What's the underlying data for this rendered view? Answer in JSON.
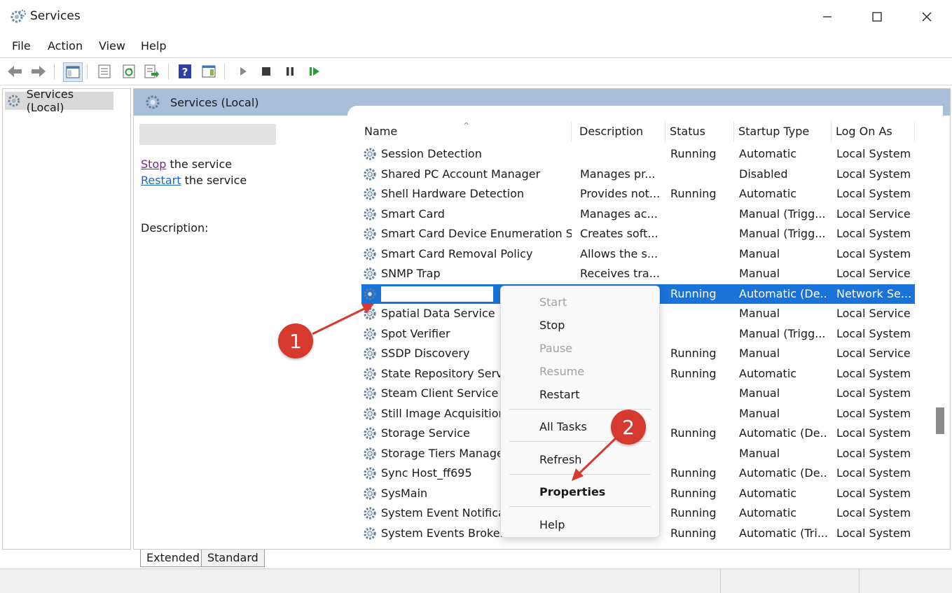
{
  "window": {
    "title": "Services"
  },
  "menu": [
    "File",
    "Action",
    "View",
    "Help"
  ],
  "tree": {
    "root": "Services (Local)"
  },
  "pane": {
    "header": "Services (Local)",
    "actions": [
      {
        "link": "Stop",
        "rest": " the service"
      },
      {
        "link": "Restart",
        "rest": " the service"
      }
    ],
    "description_label": "Description:"
  },
  "columns": [
    "Name",
    "Description",
    "Status",
    "Startup Type",
    "Log On As"
  ],
  "rows": [
    {
      "name": "Session Detection",
      "description": "",
      "status": "Running",
      "startup": "Automatic",
      "logon": "Local System"
    },
    {
      "name": "Shared PC Account Manager",
      "description": "Manages pr...",
      "status": "",
      "startup": "Disabled",
      "logon": "Local System"
    },
    {
      "name": "Shell Hardware Detection",
      "description": "Provides not...",
      "status": "Running",
      "startup": "Automatic",
      "logon": "Local System"
    },
    {
      "name": "Smart Card",
      "description": "Manages ac...",
      "status": "",
      "startup": "Manual (Trigg...",
      "logon": "Local Service"
    },
    {
      "name": "Smart Card Device Enumeration S...",
      "description": "Creates soft...",
      "status": "",
      "startup": "Manual (Trigg...",
      "logon": "Local System"
    },
    {
      "name": "Smart Card Removal Policy",
      "description": "Allows the s...",
      "status": "",
      "startup": "Manual",
      "logon": "Local System"
    },
    {
      "name": "SNMP Trap",
      "description": "Receives tra...",
      "status": "",
      "startup": "Manual",
      "logon": "Local Service"
    },
    {
      "name": "",
      "description": "",
      "status": "Running",
      "startup": "Automatic (De...",
      "logon": "Network Se...",
      "selected": true
    },
    {
      "name": "Spatial Data Service",
      "description": "",
      "status": "",
      "startup": "Manual",
      "logon": "Local Service"
    },
    {
      "name": "Spot Verifier",
      "description": "",
      "status": "",
      "startup": "Manual (Trigg...",
      "logon": "Local System"
    },
    {
      "name": "SSDP Discovery",
      "description": "",
      "status": "Running",
      "startup": "Manual",
      "logon": "Local Service"
    },
    {
      "name": "State Repository Servi",
      "description": "",
      "status": "Running",
      "startup": "Automatic",
      "logon": "Local System"
    },
    {
      "name": "Steam Client Service",
      "description": "",
      "status": "",
      "startup": "Manual",
      "logon": "Local System"
    },
    {
      "name": "Still Image Acquisition",
      "description": "",
      "status": "",
      "startup": "Manual",
      "logon": "Local System"
    },
    {
      "name": "Storage Service",
      "description": "",
      "status": "Running",
      "startup": "Automatic (De...",
      "logon": "Local System"
    },
    {
      "name": "Storage Tiers Manage",
      "description": "",
      "status": "",
      "startup": "Manual",
      "logon": "Local System"
    },
    {
      "name": "Sync Host_ff695",
      "description": "",
      "status": "Running",
      "startup": "Automatic (De...",
      "logon": "Local System"
    },
    {
      "name": "SysMain",
      "description": "",
      "status": "Running",
      "startup": "Automatic",
      "logon": "Local System"
    },
    {
      "name": "System Event Notifica",
      "description": "",
      "status": "Running",
      "startup": "Automatic",
      "logon": "Local System"
    },
    {
      "name": "System Events Broker",
      "description": "",
      "status": "Running",
      "startup": "Automatic (Tri...",
      "logon": "Local System"
    }
  ],
  "context_menu": {
    "items": [
      {
        "label": "Start",
        "disabled": true
      },
      {
        "label": "Stop",
        "disabled": false
      },
      {
        "label": "Pause",
        "disabled": true
      },
      {
        "label": "Resume",
        "disabled": true
      },
      {
        "label": "Restart",
        "disabled": false
      },
      {
        "label": "All Tasks",
        "disabled": false
      },
      {
        "label": "Refresh",
        "disabled": false
      },
      {
        "label": "Properties",
        "disabled": false,
        "bold": true
      },
      {
        "label": "Help",
        "disabled": false
      }
    ]
  },
  "tabs": [
    "Extended",
    "Standard"
  ],
  "annotations": [
    "1",
    "2"
  ],
  "colors": {
    "selection": "#1a73d9",
    "header": "#a9bfd9",
    "annotation": "#d63a2f",
    "link": "#1a66c8",
    "visited_link": "#7a1f8f"
  }
}
